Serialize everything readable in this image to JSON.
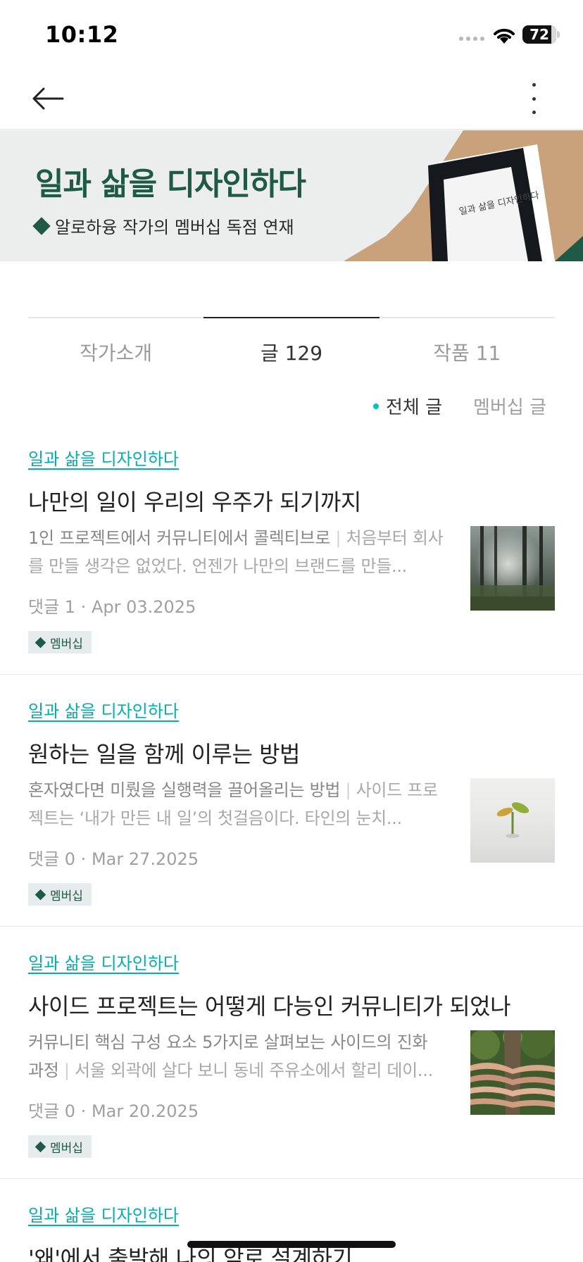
{
  "status_bar": {
    "time": "10:12",
    "battery": "72"
  },
  "header": {
    "back_icon": "arrow-left-icon",
    "more_icon": "more-vertical-icon"
  },
  "banner": {
    "title": "일과 삶을 디자인하다",
    "subtitle": "알로하융 작가의 멤버십 독점 연재",
    "book_cover_text": "일과 삶을 디자인하다",
    "colors": {
      "title": "#1e5a45",
      "background": "#eceded",
      "accent": "#c9a27c"
    }
  },
  "tabs": [
    {
      "label": "작가소개",
      "active": false
    },
    {
      "label": "글 129",
      "active": true
    },
    {
      "label": "작품 11",
      "active": false
    }
  ],
  "filters": [
    {
      "label": "전체 글",
      "active": true
    },
    {
      "label": "멤버십 글",
      "active": false
    }
  ],
  "posts": [
    {
      "magazine": "일과 삶을 디자인하다",
      "title": "나만의 일이 우리의 우주가 되기까지",
      "subtitle": "1인 프로젝트에서 커뮤니티에서 콜렉티브로",
      "excerpt": "처음부터 회사를 만들 생각은 없었다. 언젠가 나만의 브랜드를 만들...",
      "meta": "댓글 1 · Apr 03.2025",
      "badge": "멤버십",
      "thumb": "forest-image"
    },
    {
      "magazine": "일과 삶을 디자인하다",
      "title": "원하는 일을 함께 이루는 방법",
      "subtitle": "혼자였다면 미뤘을 실행력을 끌어올리는 방법",
      "excerpt": "사이드 프로젝트는 ‘내가 만든 내 일’의 첫걸음이다. 타인의 눈치...",
      "meta": "댓글 0 · Mar 27.2025",
      "badge": "멤버십",
      "thumb": "sprout-image"
    },
    {
      "magazine": "일과 삶을 디자인하다",
      "title": "사이드 프로젝트는 어떻게 다능인 커뮤니티가 되었나",
      "subtitle": "커뮤니티 핵심 구성 요소 5가지로 살펴보는 사이드의 진화 과정",
      "excerpt": "서울 외곽에 살다 보니 동네 주유소에서 할리 데이...",
      "meta": "댓글 0 · Mar 20.2025",
      "badge": "멤버십",
      "thumb": "hands-tree-image"
    },
    {
      "magazine": "일과 삶을 디자인하다",
      "title": "'왜'에서 출발해 나의 앞로 설계하기"
    }
  ]
}
